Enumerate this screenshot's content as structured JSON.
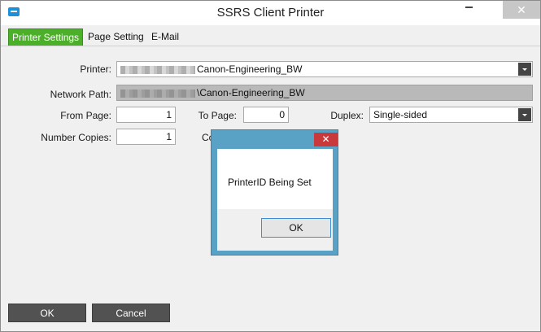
{
  "window": {
    "title": "SSRS Client Printer",
    "minimize_glyph": "",
    "close_glyph": "✕"
  },
  "tabs": [
    {
      "label": "Printer Settings",
      "active": true
    },
    {
      "label": "Page Setting",
      "active": false
    },
    {
      "label": "E-Mail",
      "active": false
    }
  ],
  "form": {
    "printer_label": "Printer:",
    "printer_value": "Canon-Engineering_BW",
    "network_path_label": "Network Path:",
    "network_path_value": "\\Canon-Engineering_BW",
    "from_page_label": "From Page:",
    "from_page_value": "1",
    "to_page_label": "To Page:",
    "to_page_value": "0",
    "duplex_label": "Duplex:",
    "duplex_value": "Single-sided",
    "copies_label": "Number Copies:",
    "copies_value": "1",
    "partial_label": "Co"
  },
  "footer": {
    "ok_label": "OK",
    "cancel_label": "Cancel"
  },
  "dialog": {
    "message": "PrinterID Being Set",
    "ok_label": "OK",
    "close_glyph": "✕"
  },
  "colors": {
    "active_tab": "#4caf2a",
    "dialog_frame": "#5aa2c5",
    "dialog_close": "#c9393b",
    "footer_button": "#525252"
  }
}
